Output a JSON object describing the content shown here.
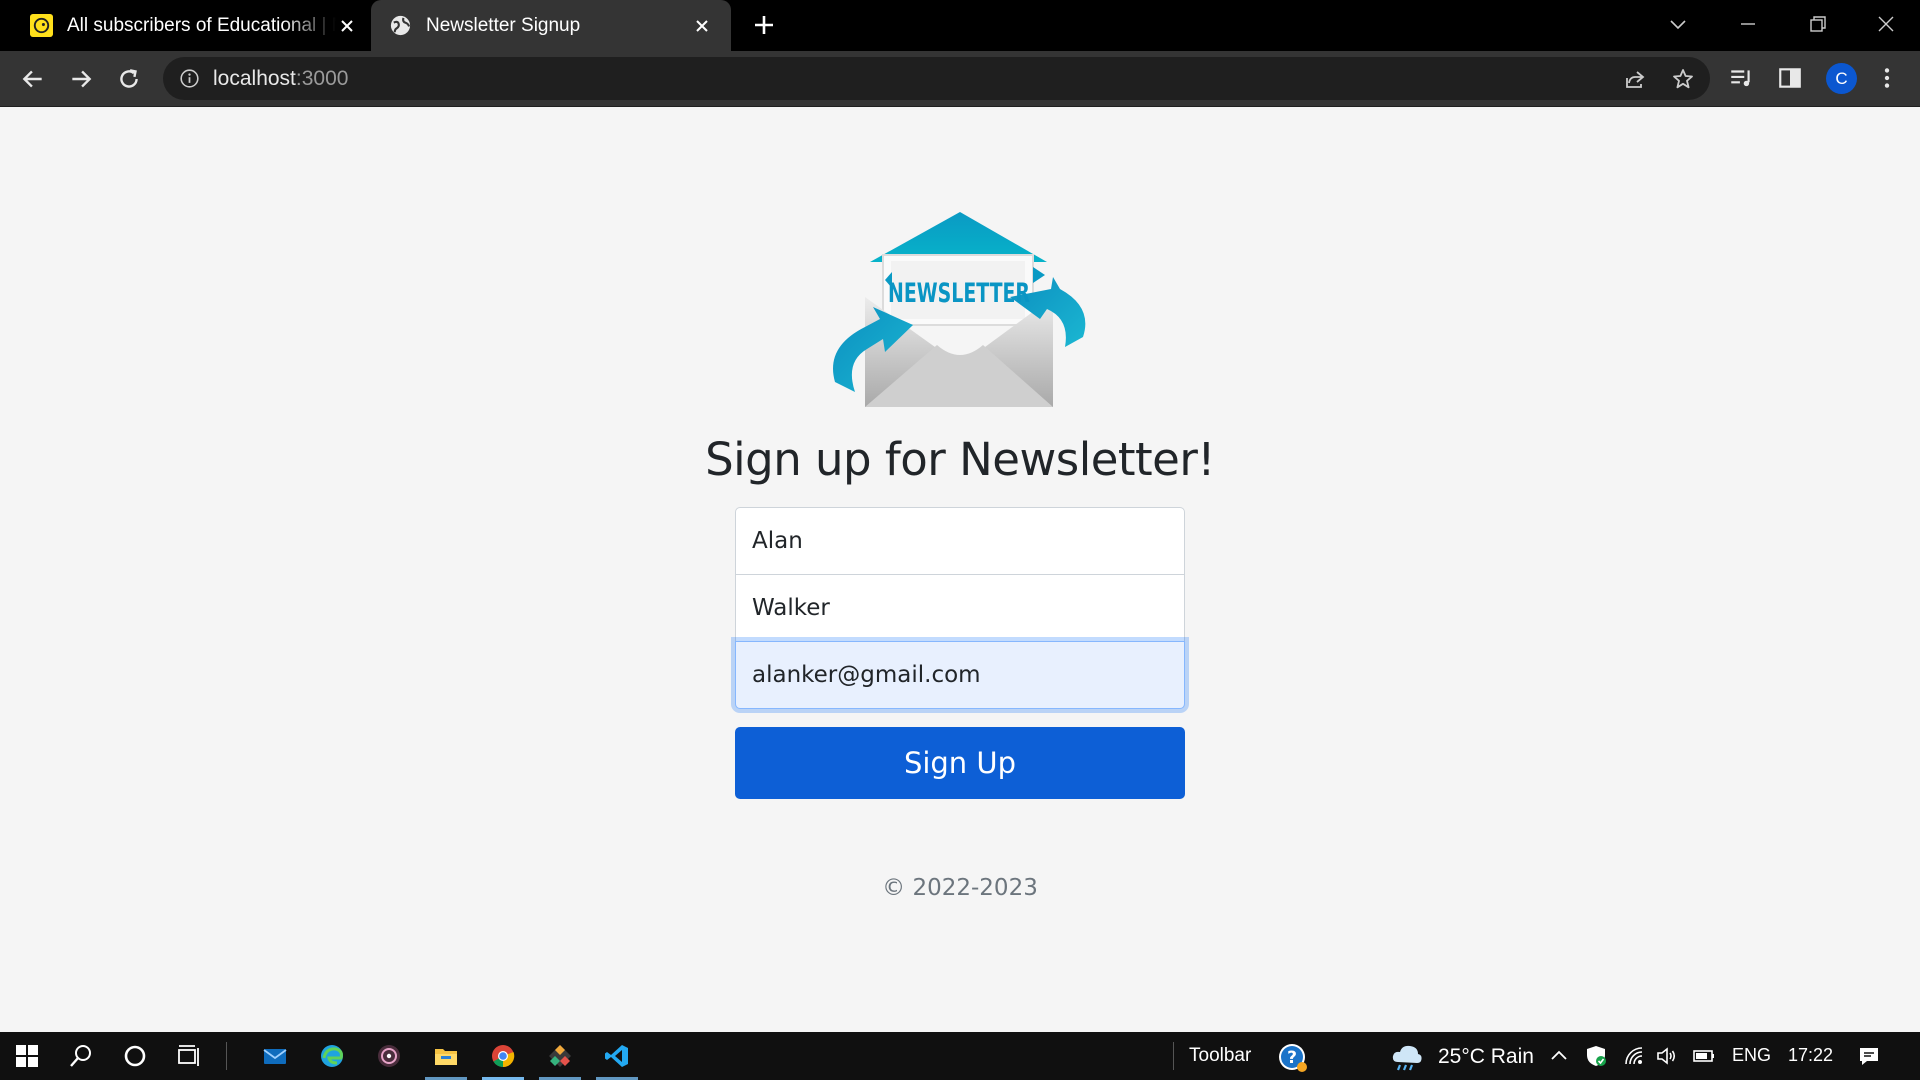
{
  "browser": {
    "tabs": [
      {
        "title": "All subscribers of Educational | M",
        "favicon": "mailchimp-icon",
        "active": false
      },
      {
        "title": "Newsletter Signup",
        "favicon": "globe-icon",
        "active": true
      }
    ],
    "url_host": "localhost",
    "url_port": ":3000",
    "profile_initial": "C"
  },
  "page": {
    "logo_text": "NEWSLETTER",
    "heading": "Sign up for Newsletter!",
    "form": {
      "first_name": "Alan",
      "last_name": "Walker",
      "email": "alanker@gmail.com",
      "submit_label": "Sign Up"
    },
    "copyright": "© 2022-2023"
  },
  "taskbar": {
    "toolbar_label": "Toolbar",
    "weather": "25°C  Rain",
    "language": "ENG",
    "time": "17:22"
  },
  "colors": {
    "primary": "#0d5fd6",
    "tab_active": "#343434",
    "page_bg": "#f5f5f5",
    "logo_teal": "#0a9ac4"
  }
}
